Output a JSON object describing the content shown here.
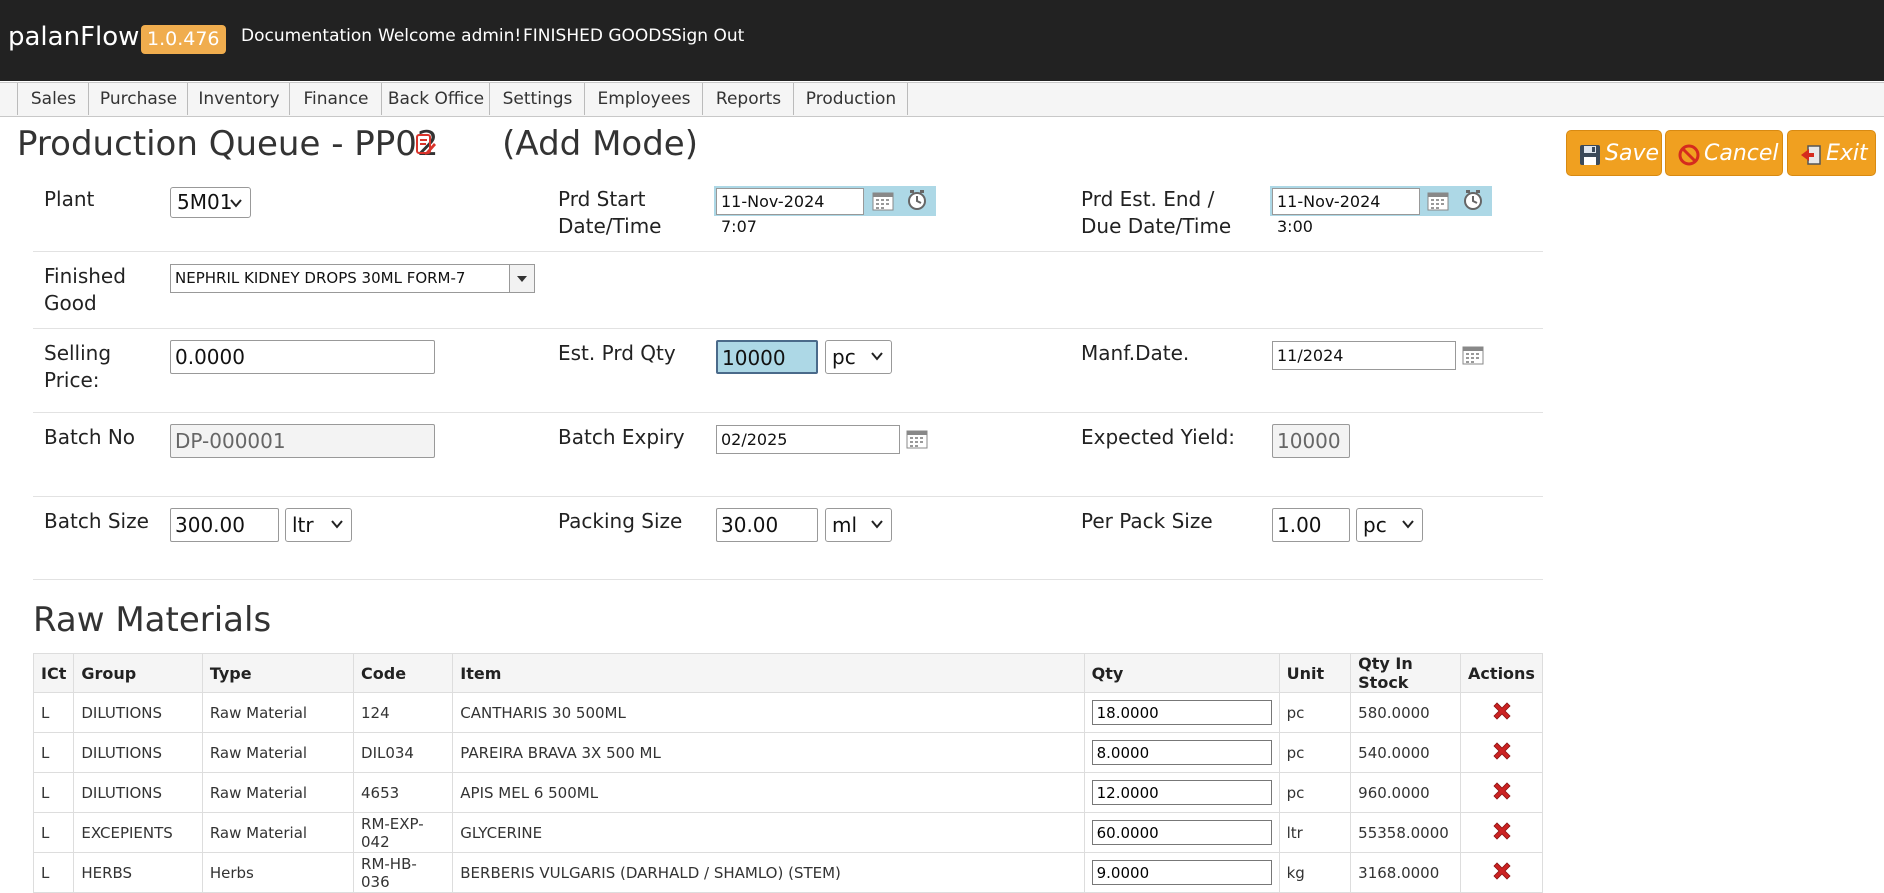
{
  "app": {
    "brand": "palanFlow",
    "version": "1.0.476",
    "links": [
      "Documentation",
      "Welcome admin!",
      "FINISHED GOODS",
      "Sign Out"
    ]
  },
  "menu": [
    "Sales",
    "Purchase",
    "Inventory",
    "Finance",
    "Back Office",
    "Settings",
    "Employees",
    "Reports",
    "Production"
  ],
  "page": {
    "title": "Production Queue - PP02",
    "mode": "(Add Mode)"
  },
  "actions": {
    "save": "Save",
    "cancel": "Cancel",
    "exit": "Exit"
  },
  "form": {
    "plant_label": "Plant",
    "plant_value": "5M01",
    "prd_start_label_1": "Prd Start",
    "prd_start_label_2": "Date/Time",
    "prd_start_value": "11-Nov-2024 7:07",
    "prd_end_label_1": "Prd Est. End /",
    "prd_end_label_2": "Due Date/Time",
    "prd_end_value": "11-Nov-2024 3:00",
    "finished_good_label_1": "Finished",
    "finished_good_label_2": "Good",
    "finished_good_value": "NEPHRIL KIDNEY DROPS 30ML FORM-7",
    "selling_price_label_1": "Selling",
    "selling_price_label_2": "Price:",
    "selling_price_value": "0.0000",
    "est_qty_label": "Est. Prd Qty",
    "est_qty_value": "10000",
    "est_qty_unit": "pc",
    "manf_date_label": "Manf.Date.",
    "manf_date_value": "11/2024",
    "batch_no_label": "Batch No",
    "batch_no_value": "DP-000001",
    "batch_expiry_label": "Batch Expiry",
    "batch_expiry_value": "02/2025",
    "expected_yield_label": "Expected Yield:",
    "expected_yield_value": "10000",
    "batch_size_label": "Batch Size",
    "batch_size_value": "300.00",
    "batch_size_unit": "ltr",
    "packing_size_label": "Packing Size",
    "packing_size_value": "30.00",
    "packing_size_unit": "ml",
    "per_pack_label": "Per Pack Size",
    "per_pack_value": "1.00",
    "per_pack_unit": "pc"
  },
  "raw_materials": {
    "title": "Raw Materials",
    "columns": [
      "ICt",
      "Group",
      "Type",
      "Code",
      "Item",
      "Qty",
      "Unit",
      "Qty In Stock",
      "Actions"
    ],
    "rows": [
      {
        "ict": "L",
        "group": "DILUTIONS",
        "type": "Raw Material",
        "code": "124",
        "item": "CANTHARIS 30 500ML",
        "qty": "18.0000",
        "unit": "pc",
        "stock": "580.0000"
      },
      {
        "ict": "L",
        "group": "DILUTIONS",
        "type": "Raw Material",
        "code": "DIL034",
        "item": "PAREIRA BRAVA 3X 500 ML",
        "qty": "8.0000",
        "unit": "pc",
        "stock": "540.0000"
      },
      {
        "ict": "L",
        "group": "DILUTIONS",
        "type": "Raw Material",
        "code": "4653",
        "item": "APIS MEL 6 500ML",
        "qty": "12.0000",
        "unit": "pc",
        "stock": "960.0000"
      },
      {
        "ict": "L",
        "group": "EXCEPIENTS",
        "type": "Raw Material",
        "code": "RM-EXP-042",
        "item": "GLYCERINE",
        "qty": "60.0000",
        "unit": "ltr",
        "stock": "55358.0000"
      },
      {
        "ict": "L",
        "group": "HERBS",
        "type": "Herbs",
        "code": "RM-HB-036",
        "item": "BERBERIS VULGARIS (DARHALD / SHAMLO) (STEM)",
        "qty": "9.0000",
        "unit": "kg",
        "stock": "3168.0000"
      }
    ]
  },
  "colors": {
    "topbar": "#222222",
    "version_badge": "#f0ad4e",
    "action_button": "#f0a020",
    "date_group": "#add8e6",
    "delete_icon": "#cc2222"
  }
}
